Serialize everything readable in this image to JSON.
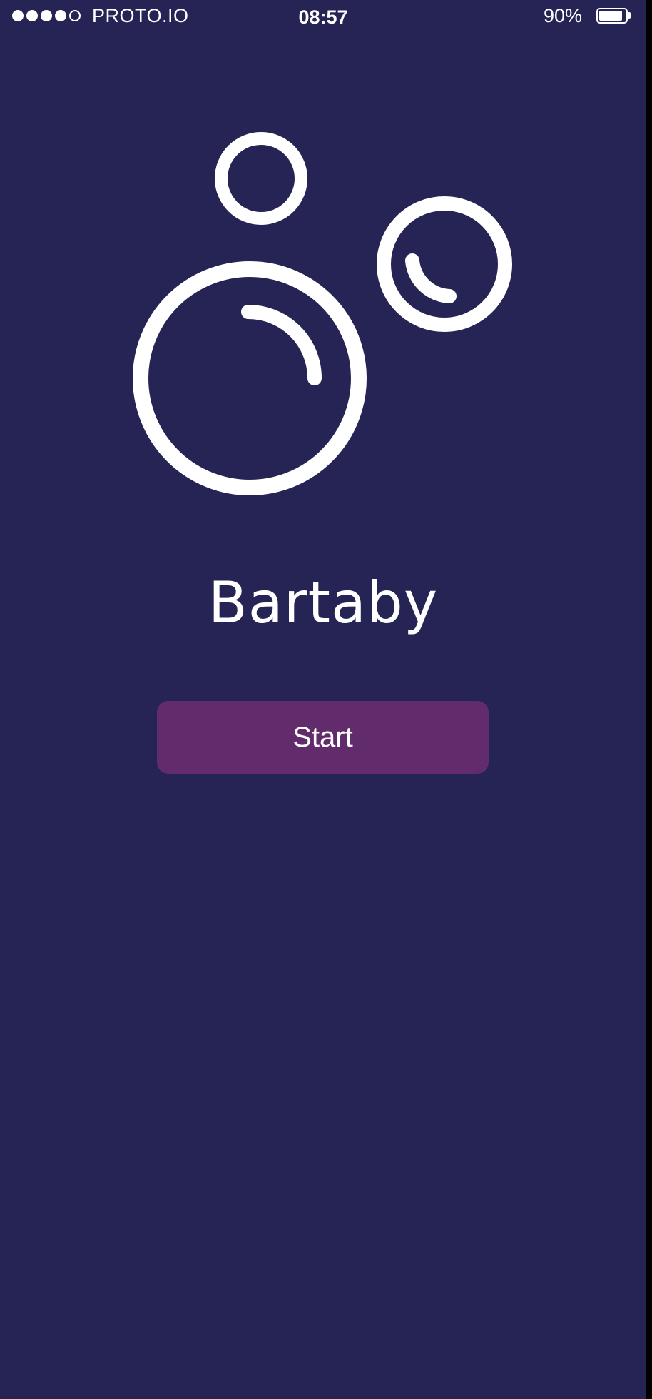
{
  "status_bar": {
    "signal_bars": 4,
    "signal_total": 5,
    "carrier": "PROTO.IO",
    "time": "08:57",
    "battery_percent": "90%",
    "battery_level": 0.9,
    "icons": [
      "signal-dots-icon",
      "battery-icon"
    ]
  },
  "app": {
    "logo_icon": "bubbles-logo-icon",
    "title": "Bartaby"
  },
  "actions": {
    "start_label": "Start"
  },
  "colors": {
    "background": "#262454",
    "button": "#622c6c",
    "foreground": "#ffffff"
  }
}
